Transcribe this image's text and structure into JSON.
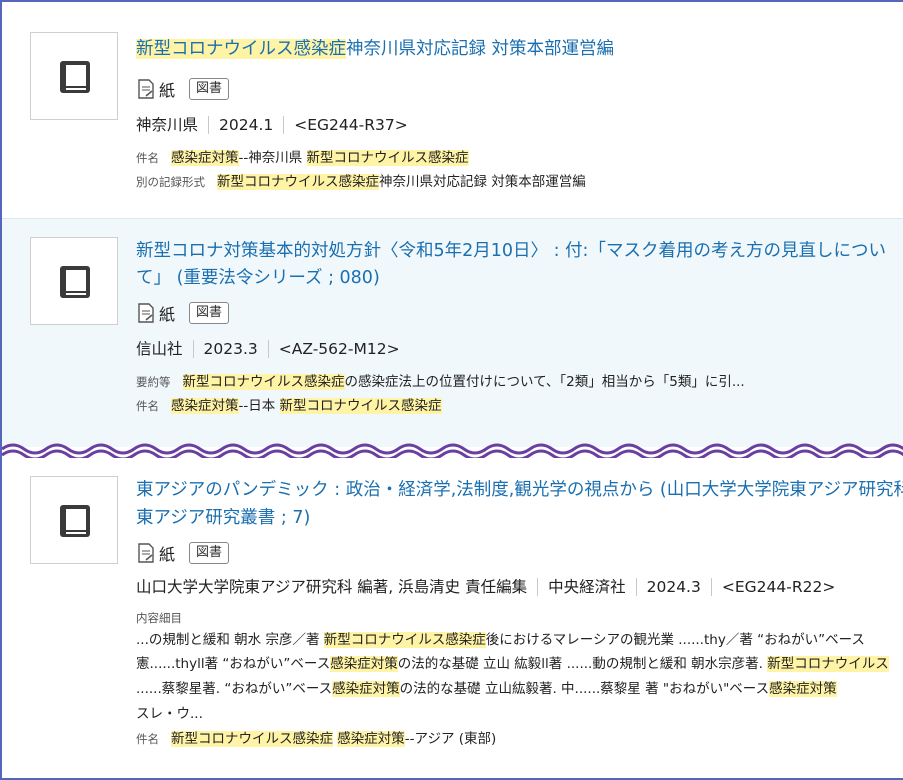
{
  "records": [
    {
      "title_hl": "新型コロナウイルス感染症",
      "title_rest": "神奈川県対応記録 対策本部運営編",
      "media_label": "紙",
      "type_badge": "図書",
      "publisher": "神奈川県",
      "date": "2024.1",
      "call_number": "<EG244-R37>",
      "subject_label": "件名",
      "subject_hl1": "感染症対策",
      "subject_mid": "--神奈川県 ",
      "subject_hl2": "新型コロナウイルス感染症",
      "alt_label": "別の記録形式",
      "alt_hl": "新型コロナウイルス感染症",
      "alt_rest": "神奈川県対応記録 対策本部運営編"
    },
    {
      "title_line1": "新型コロナ対策基本的対処方針〈令和5年2月10日〉 : 付:「マスク着用の考え方の見直しについ",
      "title_line2": "て」 (重要法令シリーズ ; 080)",
      "media_label": "紙",
      "type_badge": "図書",
      "publisher": "信山社",
      "date": "2023.3",
      "call_number": "<AZ-562-M12>",
      "summary_label": "要約等",
      "summary_hl": "新型コロナウイルス感染症",
      "summary_rest": "の感染症法上の位置付けについて、「2類」相当から「5類」に引...",
      "subject_label": "件名",
      "subject_hl1": "感染症対策",
      "subject_mid": "--日本 ",
      "subject_hl2": "新型コロナウイルス感染症"
    },
    {
      "title_line1": "東アジアのパンデミック : 政治・経済学,法制度,観光学の視点から (山口大学大学院東アジア研究科",
      "title_line2": "東アジア研究叢書 ; 7)",
      "media_label": "紙",
      "type_badge": "図書",
      "authors": "山口大学大学院東アジア研究科 編著, 浜島清史 責任編集",
      "publisher": "中央経済社",
      "date": "2024.3",
      "call_number": "<EG244-R22>",
      "contents_label": "内容細目",
      "c1_a": "...の規制と緩和 朝水 宗彦／著 ",
      "c1_hl": "新型コロナウイルス感染症",
      "c1_b": "後におけるマレーシアの観光業 ......thy／著 “おねがい”ベース",
      "c2_a": "憲......thyll著 “おねがい”ベース",
      "c2_hl1": "感染症対策",
      "c2_b": "の法的な基礎 立山 紘毅ll著 ......動の規制と緩和 朝水宗彦著. ",
      "c2_hl2": "新型コロナウイルス",
      "c3_a": "......蔡黎星著. “おねがい”ベース",
      "c3_hl1": "感染症対策",
      "c3_b": "の法的な基礎 立山紘毅著. 中......蔡黎星 著 \"おねがい\"ベース",
      "c3_hl2": "感染症対策",
      "c4": "スレ・ウ...",
      "subject_label": "件名",
      "subject_hl1": "新型コロナウイルス感染症",
      "subject_sp": " ",
      "subject_hl2": "感染症対策",
      "subject_rest": "--アジア (東部)"
    }
  ]
}
